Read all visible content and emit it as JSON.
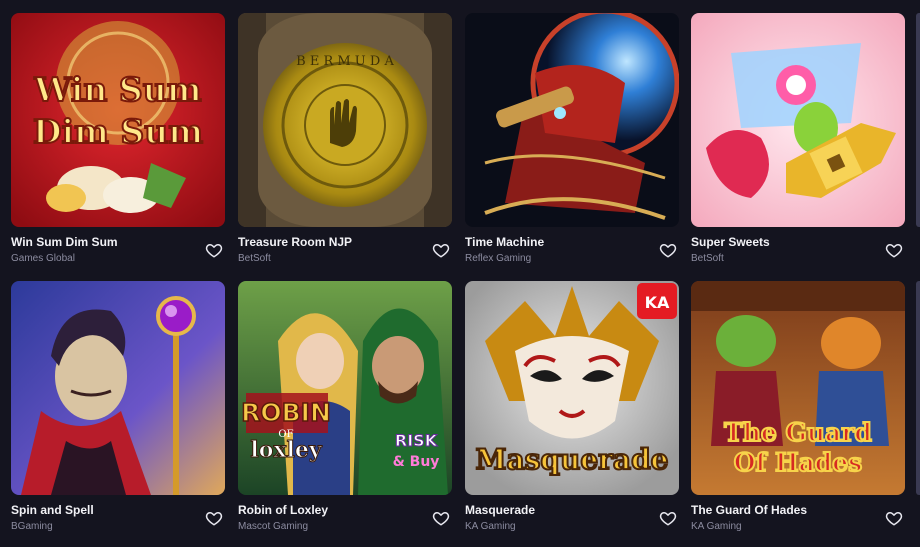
{
  "games": [
    {
      "title": "Win Sum Dim Sum",
      "provider": "Games Global",
      "art_text": [
        "Win Sum",
        "Dim Sum"
      ],
      "icon": "heart-outline"
    },
    {
      "title": "Treasure Room NJP",
      "provider": "BetSoft",
      "art_text": [
        "B E R M U D A"
      ],
      "icon": "heart-outline"
    },
    {
      "title": "Time Machine",
      "provider": "Reflex Gaming",
      "art_text": [],
      "icon": "heart-outline"
    },
    {
      "title": "Super Sweets",
      "provider": "BetSoft",
      "art_text": [],
      "icon": "heart-outline"
    },
    {
      "title": "Spin and Spell",
      "provider": "BGaming",
      "art_text": [],
      "icon": "heart-outline"
    },
    {
      "title": "Robin of Loxley",
      "provider": "Mascot Gaming",
      "art_text": [
        "ROBIN",
        "OF",
        "loxley",
        "RISK",
        "& Buy"
      ],
      "icon": "heart-outline"
    },
    {
      "title": "Masquerade",
      "provider": "KA Gaming",
      "art_text": [
        "Masquerade",
        "KA"
      ],
      "icon": "heart-outline"
    },
    {
      "title": "The Guard Of Hades",
      "provider": "KA Gaming",
      "art_text": [
        "The Guard",
        "Of Hades"
      ],
      "icon": "heart-outline"
    }
  ],
  "colors": {
    "background": "#14141f",
    "title": "#f2f2f6",
    "provider": "#8c8ca0"
  }
}
